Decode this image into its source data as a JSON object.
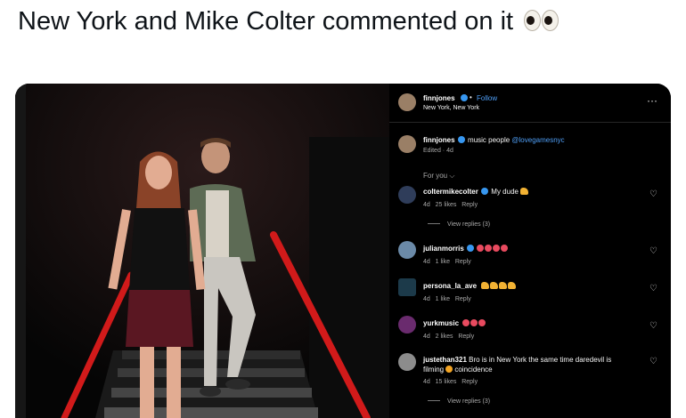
{
  "headline": {
    "text": "New York and Mike Colter commented on it",
    "emoji_icon": "eyes-emoji"
  },
  "post": {
    "header": {
      "username": "finnjones",
      "dot": "•",
      "follow": "Follow",
      "location": "New York, New York"
    },
    "caption": {
      "username": "finnjones",
      "text": "music people",
      "mention": "@lovegamesnyc",
      "meta": "Edited · 4d"
    },
    "for_you": "For you"
  },
  "comments": [
    {
      "username": "coltermikecolter",
      "text": "My dude",
      "time": "4d",
      "likes": "25 likes",
      "reply": "Reply",
      "view_replies": "View replies (3)"
    },
    {
      "username": "julianmorris",
      "text": "",
      "time": "4d",
      "likes": "1 like",
      "reply": "Reply"
    },
    {
      "username": "persona_la_ave",
      "text": "",
      "time": "4d",
      "likes": "1 like",
      "reply": "Reply"
    },
    {
      "username": "yurkmusic",
      "text": "",
      "time": "4d",
      "likes": "2 likes",
      "reply": "Reply"
    },
    {
      "username": "justethan321",
      "text": "Bro is in New York the same time daredevil is",
      "text2": "filming",
      "text3": "coincidence",
      "time": "4d",
      "likes": "15 likes",
      "reply": "Reply",
      "view_replies": "View replies (3)"
    }
  ],
  "colors": {
    "accent": "#3797f0",
    "link": "#4f9ef5",
    "stair_rail": "#d11a1a"
  }
}
